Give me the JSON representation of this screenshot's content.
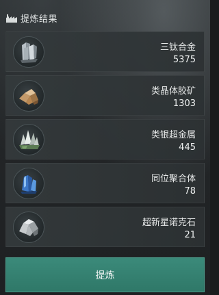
{
  "header": {
    "title": "提炼结果",
    "icon": "factory-icon"
  },
  "items": [
    {
      "name": "三钛合金",
      "quantity": "5375",
      "icon": "tri-titanium-alloy-icon"
    },
    {
      "name": "类晶体胶矿",
      "quantity": "1303",
      "icon": "crystalloid-colloid-ore-icon"
    },
    {
      "name": "类银超金属",
      "quantity": "445",
      "icon": "argentum-metal-icon"
    },
    {
      "name": "同位聚合体",
      "quantity": "78",
      "icon": "isotope-polymer-icon"
    },
    {
      "name": "超新星诺克石",
      "quantity": "21",
      "icon": "supernova-nokstone-icon"
    }
  ],
  "action": {
    "label": "提炼"
  },
  "colors": {
    "accent": "#358070",
    "panel": "#2c3032",
    "text": "#e6e8e8"
  }
}
